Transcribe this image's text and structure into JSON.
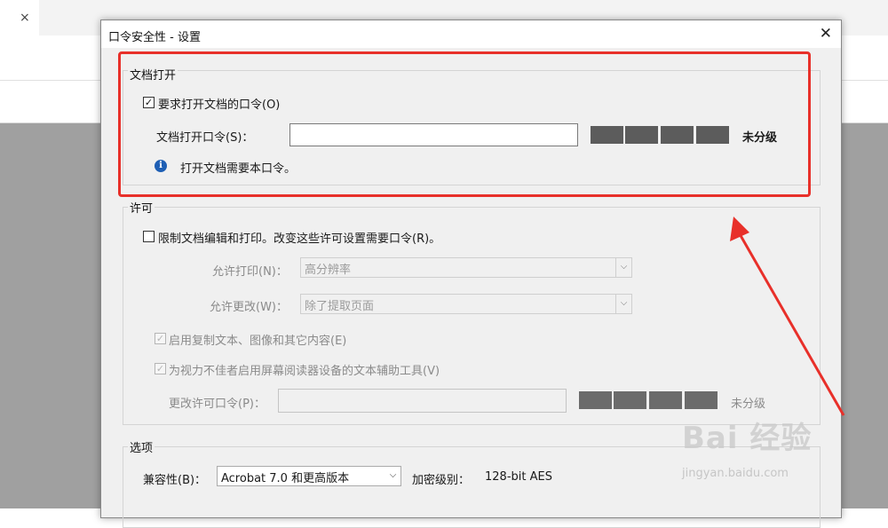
{
  "app": {
    "tab_close": "×"
  },
  "dialog": {
    "title": "口令安全性 - 设置",
    "close_glyph": "✕",
    "open_section": {
      "group_label": "文档打开",
      "require_checkbox_label": "要求打开文档的口令(O)",
      "require_checked": true,
      "password_label": "文档打开口令(S)：",
      "password_value": "",
      "strength_label": "未分级",
      "info_text": "打开文档需要本口令。"
    },
    "permissions": {
      "group_label": "许可",
      "restrict_label": "限制文档编辑和打印。改变这些许可设置需要口令(R)。",
      "restrict_checked": false,
      "print_label": "允许打印(N)：",
      "print_value": "高分辨率",
      "change_label": "允许更改(W)：",
      "change_value": "除了提取页面",
      "copy_label": "启用复制文本、图像和其它内容(E)",
      "copy_checked": true,
      "reader_label": "为视力不佳者启用屏幕阅读器设备的文本辅助工具(V)",
      "reader_checked": true,
      "perm_password_label": "更改许可口令(P)：",
      "perm_password_value": "",
      "strength_label": "未分级"
    },
    "options": {
      "group_label": "选项",
      "compat_label": "兼容性(B)：",
      "compat_value": "Acrobat 7.0 和更高版本",
      "encryption_label": "加密级别：",
      "encryption_value": "128-bit AES"
    }
  },
  "watermark": {
    "logo": "Bai 经验",
    "sub": "jingyan.baidu.com"
  },
  "colors": {
    "highlight": "#e8302a",
    "meter": "#5c5c5c",
    "info": "#1e5fb4"
  }
}
